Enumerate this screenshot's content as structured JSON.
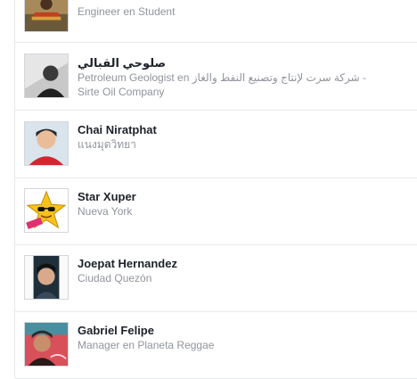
{
  "friends": [
    {
      "name": "",
      "subtitle": "Engineer en Student",
      "avatar": "guitar-player-photo"
    },
    {
      "name": "صلوحي القبالي",
      "subtitle": "Petroleum Geologist en شركة سرت لإنتاج وتصنيع النفط والغاز - Sirte Oil Company",
      "avatar": "grayscale-portrait-photo"
    },
    {
      "name": "Chai Niratphat",
      "subtitle": "แนงมุดวิทยา",
      "avatar": "boy-red-shirt-photo"
    },
    {
      "name": "Star Xuper",
      "subtitle": "Nueva York",
      "avatar": "cartoon-star-sunglasses"
    },
    {
      "name": "Joepat Hernandez",
      "subtitle": "Ciudad Quezón",
      "avatar": "young-man-photo"
    },
    {
      "name": "Gabriel Felipe",
      "subtitle": "Manager en Planeta Reggae",
      "avatar": "reggae-portrait-photo"
    }
  ],
  "colors": {
    "name_text": "#1d2129",
    "subtitle_text": "#90949c",
    "divider": "#e9eaed"
  }
}
